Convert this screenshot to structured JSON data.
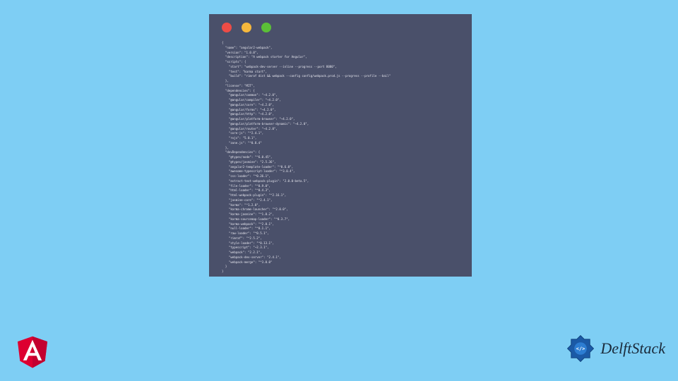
{
  "window": {
    "dot_red": "close",
    "dot_yellow": "minimize",
    "dot_green": "zoom"
  },
  "brand": {
    "delft_text": "DelftStack"
  },
  "package": {
    "name": "angular2-webpack",
    "version": "1.0.0",
    "description": "A webpack starter for Angular",
    "scripts": {
      "start": "webpack-dev-server --inline --progress --port 8080",
      "test": "karma start",
      "build": "rimraf dist && webpack --config config/webpack.prod.js --progress --profile --bail"
    },
    "license": "MIT",
    "dependencies": {
      "@angular/common": "~4.2.0",
      "@angular/compiler": "~4.2.0",
      "@angular/core": "~4.2.0",
      "@angular/forms": "~4.2.0",
      "@angular/http": "~4.2.0",
      "@angular/platform-browser": "~4.2.0",
      "@angular/platform-browser-dynamic": "~4.2.0",
      "@angular/router": "~4.2.0",
      "core-js": "^2.4.1",
      "rxjs": "5.0.1",
      "zone.js": "^0.8.4"
    },
    "devDependencies": {
      "@types/node": "^6.0.45",
      "@types/jasmine": "2.5.36",
      "angular2-template-loader": "^0.6.0",
      "awesome-typescript-loader": "^3.0.4",
      "css-loader": "^0.26.1",
      "extract-text-webpack-plugin": "2.0.0-beta.5",
      "file-loader": "^0.9.0",
      "html-loader": "^0.4.3",
      "html-webpack-plugin": "^2.16.1",
      "jasmine-core": "^2.4.1",
      "karma": "^1.2.0",
      "karma-chrome-launcher": "^2.0.0",
      "karma-jasmine": "^1.0.2",
      "karma-sourcemap-loader": "^0.3.7",
      "karma-webpack": "^2.0.1",
      "null-loader": "^0.1.1",
      "raw-loader": "^0.5.1",
      "rimraf": "^2.5.2",
      "style-loader": "^0.13.1",
      "typescript": "~2.3.1",
      "webpack": "2.2.1",
      "webpack-dev-server": "2.4.1",
      "webpack-merge": "^3.0.0"
    }
  }
}
